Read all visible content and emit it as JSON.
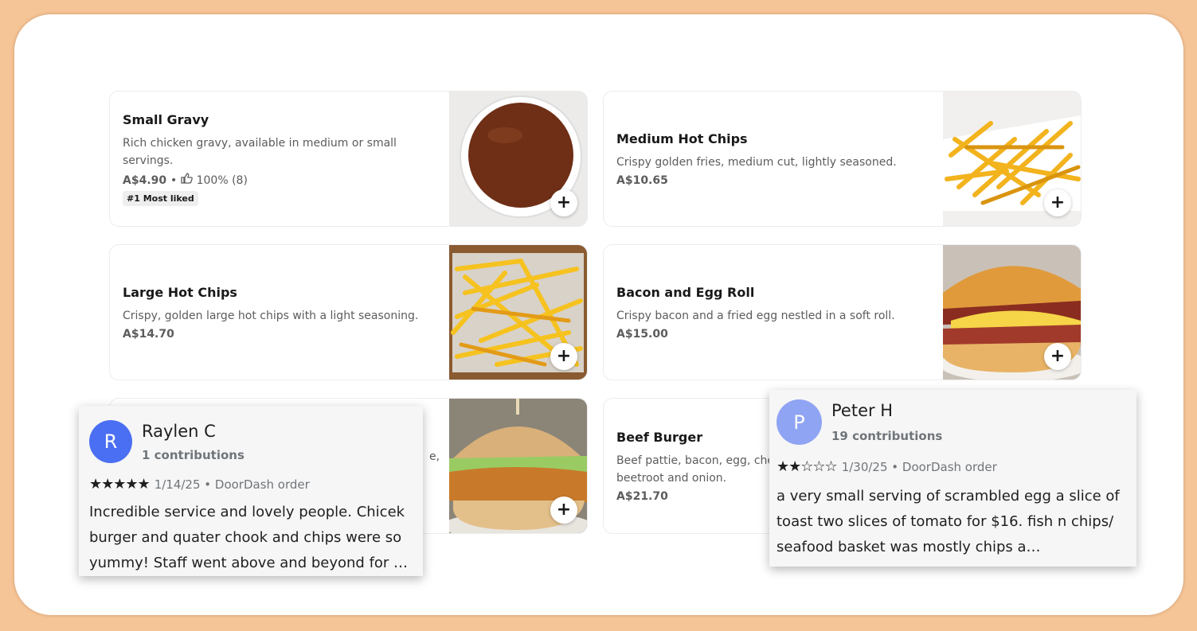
{
  "menu_items": [
    {
      "name": "Small Gravy",
      "description": "Rich chicken gravy, available in medium or small servings.",
      "price": "A$4.90",
      "rating": "100% (8)",
      "badge": "#1 Most liked",
      "add_label": "+"
    },
    {
      "name": "Medium Hot Chips",
      "description": "Crispy golden fries, medium cut, lightly seasoned.",
      "price": "A$10.65",
      "add_label": "+"
    },
    {
      "name": "Large Hot Chips",
      "description": "Crispy, golden large hot chips with a light seasoning.",
      "price": "A$14.70",
      "add_label": "+"
    },
    {
      "name": "Bacon and Egg Roll",
      "description": "Crispy bacon and a fried egg nestled in a soft roll.",
      "price": "A$15.00",
      "add_label": "+"
    },
    {
      "name": "",
      "description": "",
      "price": "",
      "partial_text": "e,",
      "add_label": "+"
    },
    {
      "name": "Beef Burger",
      "description": "Beef pattie, bacon, egg, che",
      "description_line2": "beetroot and onion.",
      "price": "A$21.70"
    }
  ],
  "reviews": [
    {
      "initial": "R",
      "avatar_color": "#4a6ff2",
      "name": "Raylen C",
      "contributions": "1 contributions",
      "stars": "★★★★★",
      "date": "1/14/25 • DoorDash order",
      "text": "Incredible service and lovely people. Chicek burger and quater chook and chips were so yummy! Staff went above and beyond for …"
    },
    {
      "initial": "P",
      "avatar_color": "#8fa4f3",
      "name": "Peter H",
      "contributions": "19 contributions",
      "stars": "★★☆☆☆",
      "date": "1/30/25 • DoorDash order",
      "text": "a very small serving of scrambled egg a slice of toast two slices of tomato for $16. fish n chips/ seafood basket was mostly chips a…"
    }
  ],
  "images": {
    "gravy": "gravy-bowl-photo",
    "chips": "hot-chips-photo",
    "bacon_egg_roll": "bacon-egg-roll-photo",
    "burger": "chicken-burger-photo"
  },
  "colors": {
    "page_background": "#f6c597",
    "card_border": "#ececec",
    "avatar_r": "#4a6ff2",
    "avatar_p": "#8fa4f3"
  }
}
